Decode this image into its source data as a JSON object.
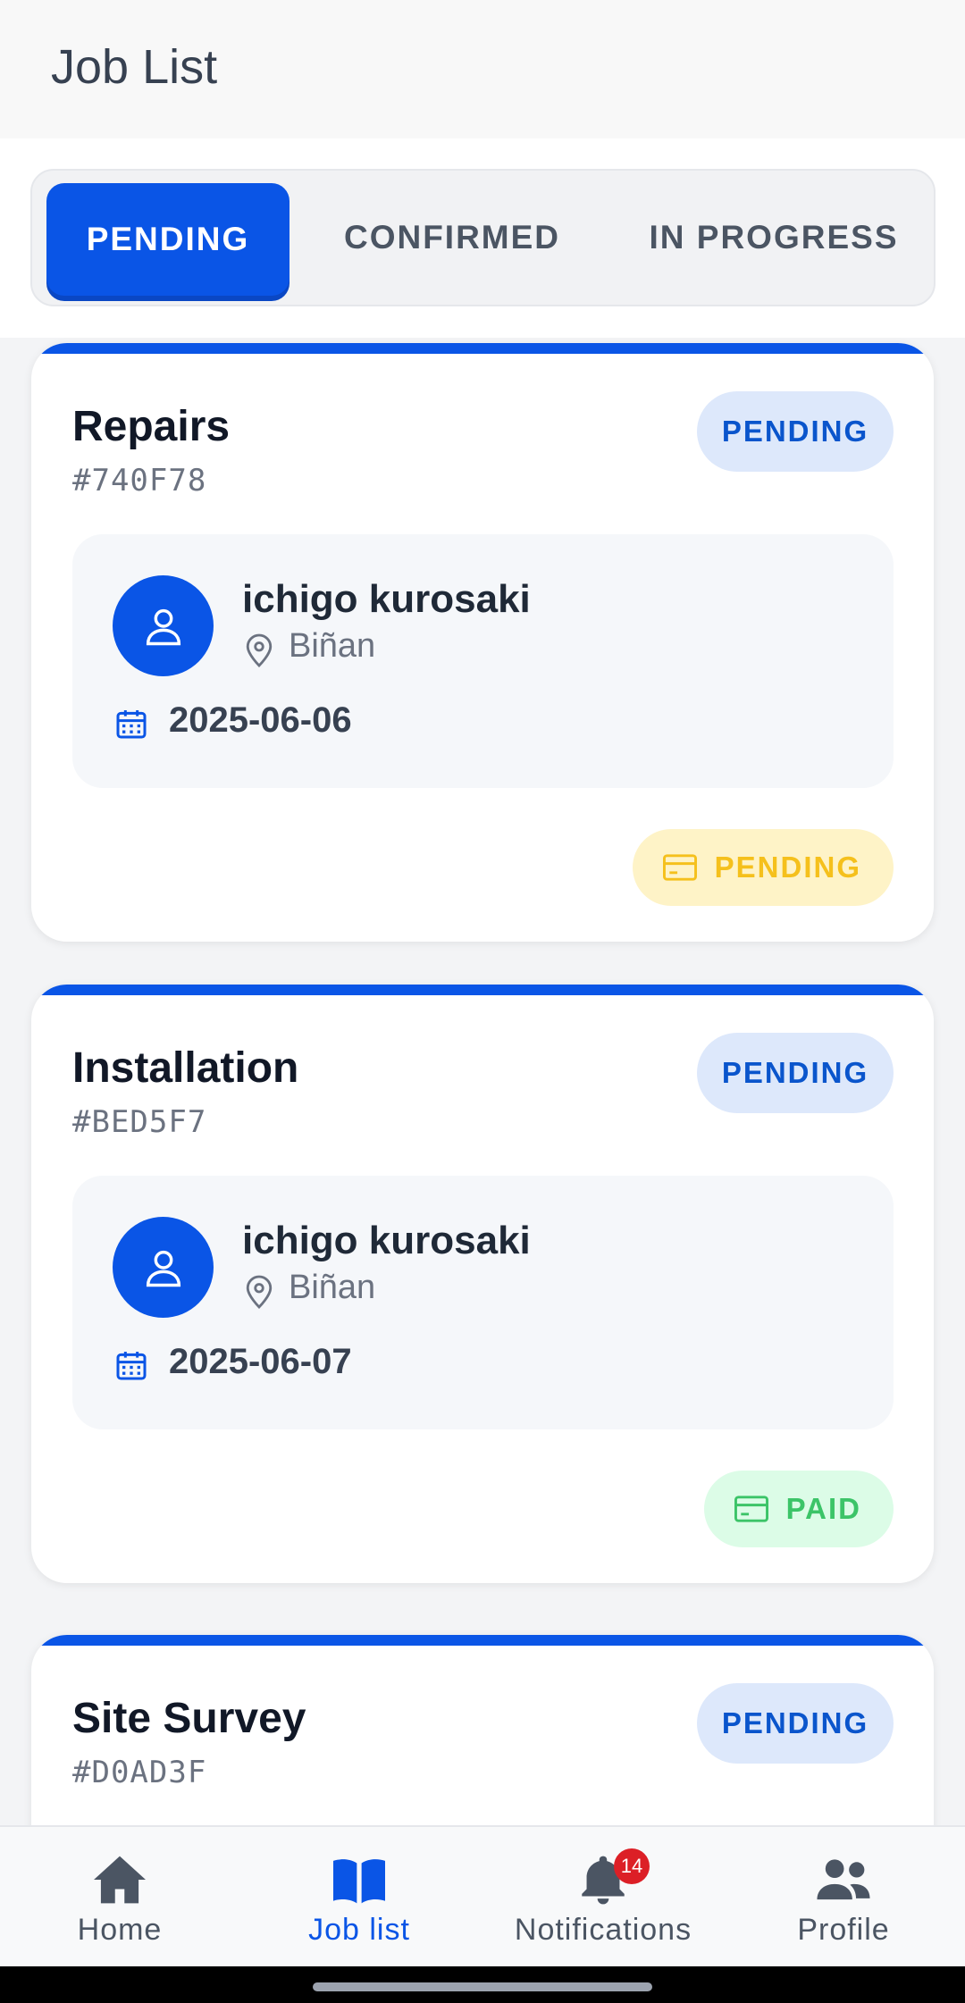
{
  "header": {
    "title": "Job List"
  },
  "tabs": [
    {
      "label": "PENDING",
      "active": true
    },
    {
      "label": "CONFIRMED",
      "active": false
    },
    {
      "label": "IN PROGRESS",
      "active": false
    }
  ],
  "jobs": [
    {
      "title": "Repairs",
      "id": "#740F78",
      "status": "PENDING",
      "client": "ichigo kurosaki",
      "location": "Biñan",
      "date": "2025-06-06",
      "payment": "PENDING"
    },
    {
      "title": "Installation",
      "id": "#BED5F7",
      "status": "PENDING",
      "client": "ichigo kurosaki",
      "location": "Biñan",
      "date": "2025-06-07",
      "payment": "PAID"
    },
    {
      "title": "Site Survey",
      "id": "#D0AD3F",
      "status": "PENDING"
    }
  ],
  "nav": {
    "items": [
      {
        "label": "Home",
        "icon": "home-icon"
      },
      {
        "label": "Job list",
        "icon": "book-icon",
        "active": true
      },
      {
        "label": "Notifications",
        "icon": "bell-icon",
        "badge": "14"
      },
      {
        "label": "Profile",
        "icon": "people-icon"
      }
    ]
  },
  "colors": {
    "primary": "#0A55E6",
    "pending_status_bg": "#DDE8FB",
    "payment_pending": "#F5C01C",
    "payment_paid": "#3CC468",
    "badge": "#DC1F26"
  }
}
